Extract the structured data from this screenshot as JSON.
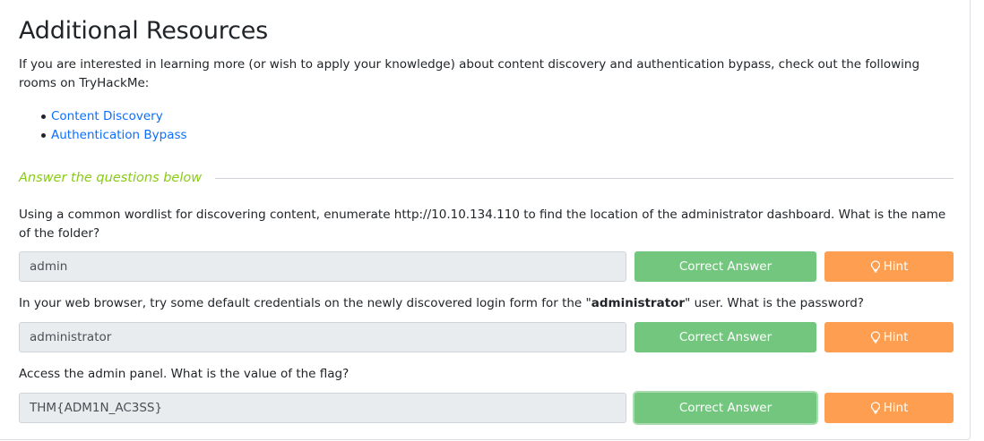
{
  "task": {
    "title": "Additional Resources",
    "intro": "If you are interested in learning more  (or wish to apply your knowledge) about content discovery and authentication bypass, check out the following rooms on TryHackMe:",
    "links": [
      {
        "label": "Content Discovery"
      },
      {
        "label": "Authentication Bypass"
      }
    ]
  },
  "questions_header": "Answer the questions below",
  "questions": [
    {
      "text": "Using a common wordlist for discovering content, enumerate http://10.10.134.110 to find the location of the administrator dashboard. What is the name of the folder?",
      "answer": "admin",
      "submit_label": "Correct Answer",
      "hint_label": "Hint"
    },
    {
      "text_before": "In your web browser, try some default credentials on the newly discovered login form for the \"",
      "text_bold": "administrator",
      "text_after": "\" user. What is the password?",
      "answer": "administrator",
      "submit_label": "Correct Answer",
      "hint_label": "Hint"
    },
    {
      "text": "Access the admin panel. What is the value of the flag?",
      "answer": "THM{ADM1N_AC3SS}",
      "submit_label": "Correct Answer",
      "hint_label": "Hint"
    }
  ],
  "colors": {
    "accent_green": "#88cc14",
    "correct_button": "#72c67d",
    "hint_button": "#fd9e50",
    "link": "#0d6efd"
  },
  "icons": {
    "hint": "lightbulb-icon",
    "list_marker": "bullet-icon"
  }
}
